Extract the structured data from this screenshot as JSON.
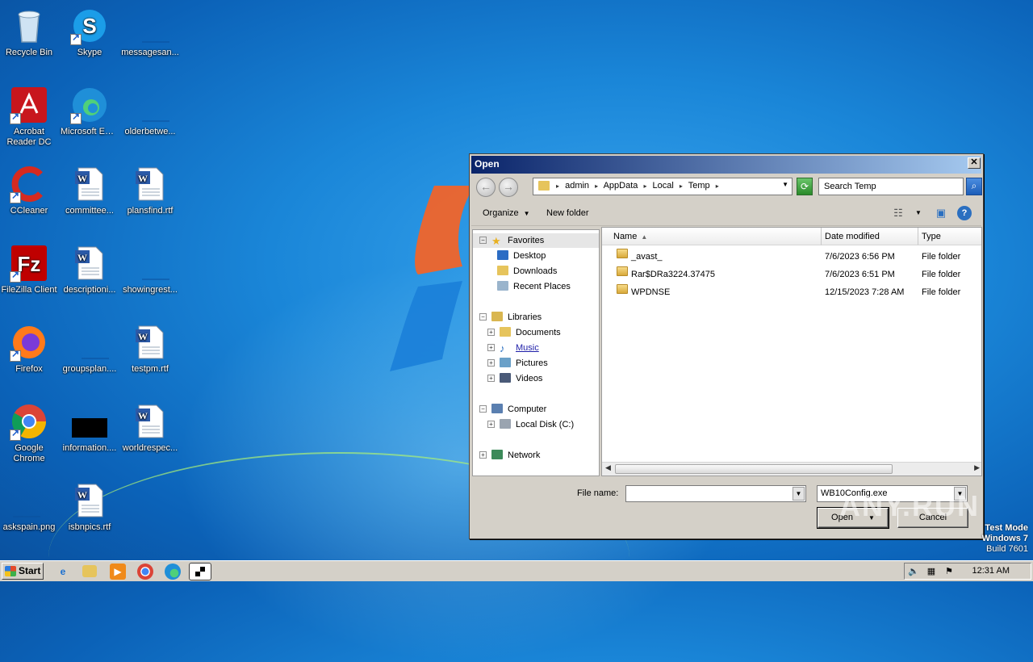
{
  "desktop": {
    "icons": [
      {
        "label": "Recycle Bin",
        "icon": "recycle-bin-icon"
      },
      {
        "label": "Skype",
        "icon": "skype-icon"
      },
      {
        "label": "messagesan...",
        "icon": "blank-file-icon"
      },
      {
        "label": "Acrobat Reader DC",
        "icon": "acrobat-icon"
      },
      {
        "label": "Microsoft Edge",
        "icon": "edge-icon"
      },
      {
        "label": "olderbetwe...",
        "icon": "blank-file-icon"
      },
      {
        "label": "CCleaner",
        "icon": "ccleaner-icon"
      },
      {
        "label": "committee...",
        "icon": "word-doc-icon"
      },
      {
        "label": "plansfind.rtf",
        "icon": "word-doc-icon"
      },
      {
        "label": "FileZilla Client",
        "icon": "filezilla-icon"
      },
      {
        "label": "descriptioni...",
        "icon": "word-doc-icon"
      },
      {
        "label": "showingrest...",
        "icon": "blank-file-icon"
      },
      {
        "label": "Firefox",
        "icon": "firefox-icon"
      },
      {
        "label": "groupsplan....",
        "icon": "blank-file-icon"
      },
      {
        "label": "testpm.rtf",
        "icon": "word-doc-icon"
      },
      {
        "label": "Google Chrome",
        "icon": "chrome-icon"
      },
      {
        "label": "information....",
        "icon": "black-file-icon"
      },
      {
        "label": "worldrespec...",
        "icon": "word-doc-icon"
      },
      {
        "label": "askspain.png",
        "icon": "blank-file-icon"
      },
      {
        "label": "isbnpics.rtf",
        "icon": "word-doc-icon"
      }
    ]
  },
  "dialog": {
    "title": "Open",
    "close_label": "✕",
    "breadcrumb": [
      "admin",
      "AppData",
      "Local",
      "Temp"
    ],
    "search_placeholder": "Search Temp",
    "toolbar": {
      "organize": "Organize",
      "new_folder": "New folder"
    },
    "nav": {
      "favorites": "Favorites",
      "desktop": "Desktop",
      "downloads": "Downloads",
      "recent_places": "Recent Places",
      "libraries": "Libraries",
      "documents": "Documents",
      "music": "Music",
      "pictures": "Pictures",
      "videos": "Videos",
      "computer": "Computer",
      "local_disk": "Local Disk (C:)",
      "network": "Network"
    },
    "columns": {
      "name": "Name",
      "date": "Date modified",
      "type": "Type"
    },
    "files": [
      {
        "name": "_avast_",
        "date": "7/6/2023 6:56 PM",
        "type": "File folder"
      },
      {
        "name": "Rar$DRa3224.37475",
        "date": "7/6/2023 6:51 PM",
        "type": "File folder"
      },
      {
        "name": "WPDNSE",
        "date": "12/15/2023 7:28 AM",
        "type": "File folder"
      }
    ],
    "file_name_label": "File name:",
    "file_name_value": "",
    "file_type_value": "WB10Config.exe",
    "open_label": "Open",
    "cancel_label": "Cancel"
  },
  "taskbar": {
    "start_label": "Start",
    "clock": "12:31 AM"
  },
  "watermark": {
    "line1": "Test Mode",
    "line2": "Windows 7",
    "line3": "Build 7601",
    "brand": "ANY.RUN"
  }
}
